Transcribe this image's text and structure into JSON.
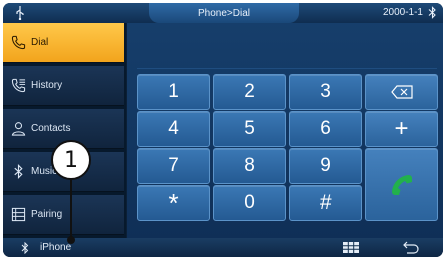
{
  "topbar": {
    "title": "Phone>Dial",
    "date": "2000-1-1",
    "usb_icon": "usb-icon",
    "bt_icon": "bluetooth-icon"
  },
  "sidebar": {
    "items": [
      {
        "label": "Dial",
        "icon": "phone-icon",
        "active": true
      },
      {
        "label": "History",
        "icon": "call-history-icon",
        "active": false
      },
      {
        "label": "Contacts",
        "icon": "contacts-icon",
        "active": false
      },
      {
        "label": "Music",
        "icon": "bluetooth-icon",
        "active": false
      },
      {
        "label": "Pairing",
        "icon": "pairing-list-icon",
        "active": false
      }
    ]
  },
  "keypad": {
    "keys": [
      "1",
      "2",
      "3",
      "4",
      "5",
      "6",
      "7",
      "8",
      "9",
      "*",
      "0",
      "#"
    ],
    "plus": "+",
    "backspace_icon": "backspace-icon",
    "call_icon": "call-icon"
  },
  "bottombar": {
    "device": "iPhone",
    "keypad_icon": "keypad-grid-icon",
    "back_icon": "back-icon"
  },
  "annotation": {
    "number": "1"
  },
  "colors": {
    "active": "#f6b22c",
    "call_green": "#22b14c",
    "key_blue": "#2f6aa6"
  }
}
